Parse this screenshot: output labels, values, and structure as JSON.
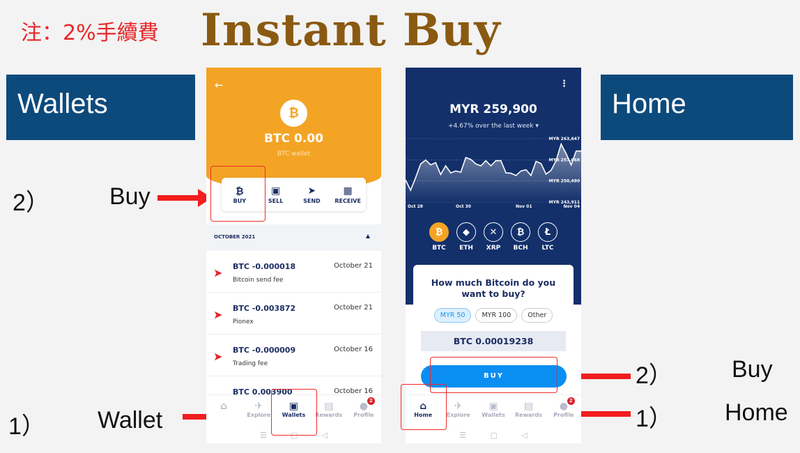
{
  "header": {
    "note": "注：2%手續費",
    "title": "Instant Buy"
  },
  "labels": {
    "wallets_box": "Wallets",
    "home_box": "Home",
    "left_step2": "2）",
    "left_buy": "Buy",
    "left_step1": "1）",
    "left_wallet": "Wallet",
    "right_step2": "2）",
    "right_buy": "Buy",
    "right_step1": "1）",
    "right_home": "Home"
  },
  "wallet_screen": {
    "balance": "BTC 0.00",
    "subtitle": "BTC wallet",
    "actions": [
      {
        "label": "BUY",
        "icon": "bitcoin-icon"
      },
      {
        "label": "SELL",
        "icon": "cash-icon"
      },
      {
        "label": "SEND",
        "icon": "send-icon"
      },
      {
        "label": "RECEIVE",
        "icon": "qr-icon"
      }
    ],
    "month": "OCTOBER 2021",
    "transactions": [
      {
        "amount": "BTC -0.000018",
        "desc": "Bitcoin send fee",
        "date": "October 21"
      },
      {
        "amount": "BTC -0.003872",
        "desc": "Pionex",
        "date": "October 21"
      },
      {
        "amount": "BTC -0.000009",
        "desc": "Trading fee",
        "date": "October 16"
      },
      {
        "amount": "BTC 0.003900",
        "desc": "",
        "date": "October 16"
      }
    ],
    "nav": [
      {
        "label": "",
        "icon": "home-icon"
      },
      {
        "label": "Explore",
        "icon": "telescope-icon"
      },
      {
        "label": "Wallets",
        "icon": "wallet-icon",
        "active": true
      },
      {
        "label": "Rewards",
        "icon": "gift-icon"
      },
      {
        "label": "Profile",
        "icon": "profile-icon",
        "badge": "2"
      }
    ]
  },
  "home_screen": {
    "price": "MYR 259,900",
    "change": "+4.67% over the last week",
    "coins": [
      "BTC",
      "ETH",
      "XRP",
      "BCH",
      "LTC"
    ],
    "question": "How much Bitcoin do you want to buy?",
    "options": [
      "MYR 50",
      "MYR 100",
      "Other"
    ],
    "selected_option": "MYR 50",
    "btc_amount": "BTC 0.00019238",
    "buy_label": "BUY",
    "nav": [
      {
        "label": "Home",
        "icon": "home-icon",
        "active": true
      },
      {
        "label": "Explore",
        "icon": "telescope-icon"
      },
      {
        "label": "Wallets",
        "icon": "wallet-icon"
      },
      {
        "label": "Rewards",
        "icon": "gift-icon"
      },
      {
        "label": "Profile",
        "icon": "profile-icon",
        "badge": "2"
      }
    ]
  },
  "chart_data": {
    "type": "area",
    "x_ticks": [
      "Oct 28",
      "Oct 30",
      "Nov 01",
      "Nov 04"
    ],
    "y_ticks": [
      "MYR 263,647",
      "MYR 257,068",
      "MYR 250,490",
      "MYR 243,911"
    ],
    "ylim": [
      243911,
      263647
    ],
    "values": [
      250800,
      247600,
      251500,
      255800,
      257000,
      255500,
      256200,
      252500,
      255200,
      253000,
      253600,
      253200,
      257800,
      257200,
      255800,
      255200,
      256800,
      255200,
      256800,
      256800,
      253000,
      252900,
      252200,
      253600,
      254000,
      252200,
      256600,
      255900,
      252600,
      253800,
      256800,
      262000,
      259000,
      255500,
      259800,
      259800
    ],
    "colors": {
      "line": "#ffffff",
      "background": "#13306b"
    }
  }
}
